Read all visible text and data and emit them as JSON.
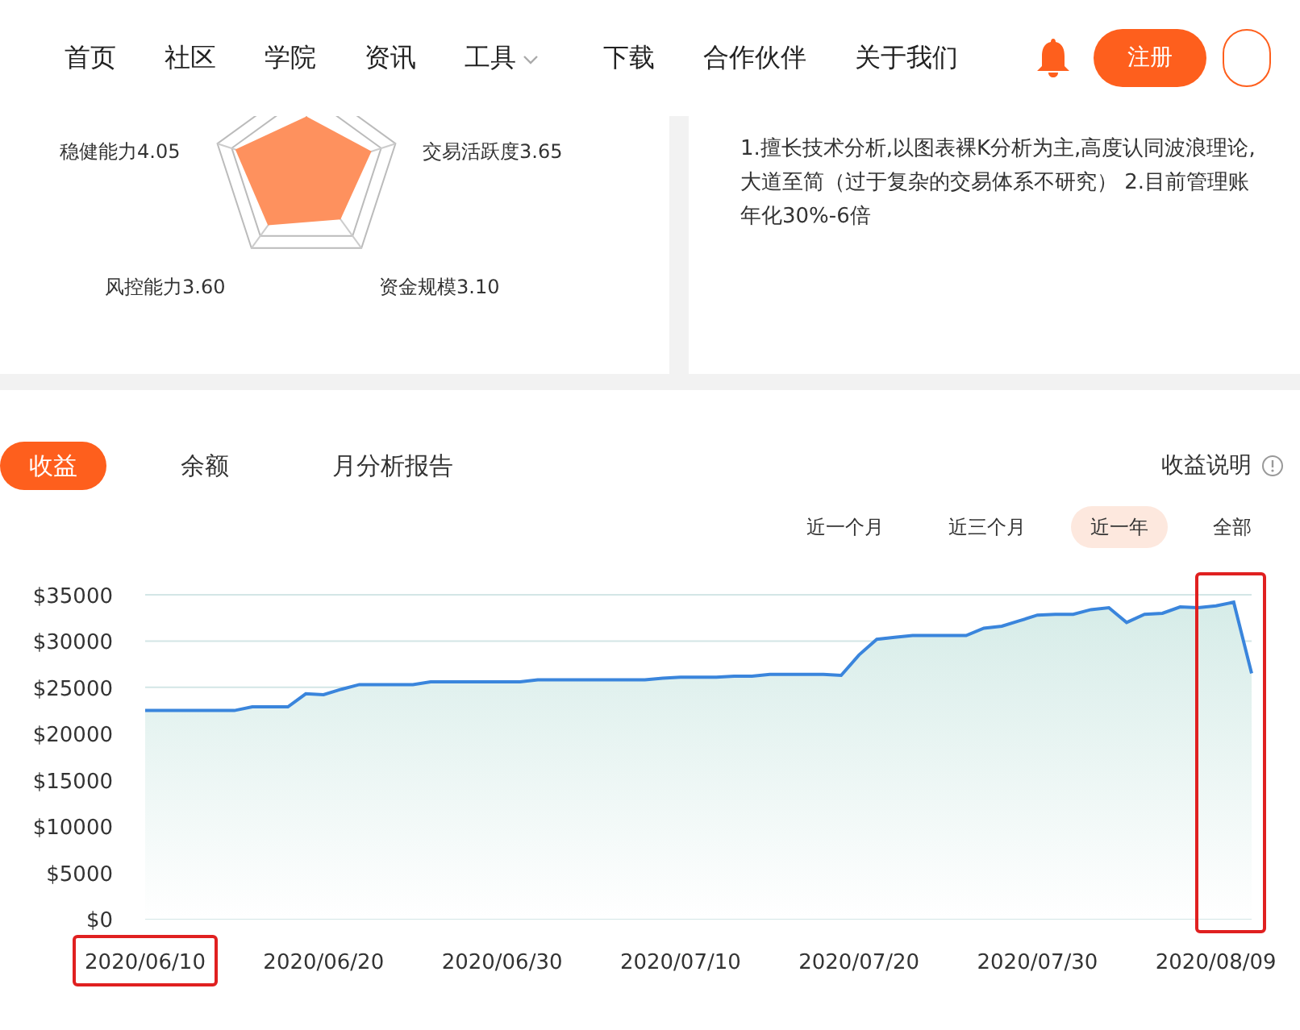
{
  "nav": {
    "items": [
      {
        "label": "首页",
        "dropdown": false
      },
      {
        "label": "社区",
        "dropdown": false
      },
      {
        "label": "学院",
        "dropdown": false
      },
      {
        "label": "资讯",
        "dropdown": false
      },
      {
        "label": "工具",
        "dropdown": true
      },
      {
        "label": "下载",
        "dropdown": false
      },
      {
        "label": "合作伙伴",
        "dropdown": false
      },
      {
        "label": "关于我们",
        "dropdown": false
      }
    ],
    "register": "注册"
  },
  "radar": {
    "labels": [
      {
        "text": "稳健能力4.05"
      },
      {
        "text": "交易活跃度3.65"
      },
      {
        "text": "风控能力3.60"
      },
      {
        "text": "资金规模3.10"
      }
    ]
  },
  "description": {
    "lines": [
      "1.擅长技术分析,以图表裸K分析为主,高度认同波浪理论,",
      "大道至简（过于复杂的交易体系不研究） 2.目前管理账",
      "年化30%-6倍"
    ]
  },
  "tabs": [
    {
      "label": "收益",
      "selected": true
    },
    {
      "label": "余额",
      "selected": false
    },
    {
      "label": "月分析报告",
      "selected": false
    }
  ],
  "explain": "收益说明",
  "ranges": [
    {
      "label": "近一个月",
      "selected": false
    },
    {
      "label": "近三个月",
      "selected": false
    },
    {
      "label": "近一年",
      "selected": true
    },
    {
      "label": "全部",
      "selected": false
    }
  ],
  "chart_data": {
    "type": "area",
    "ylim": [
      0,
      35000
    ],
    "yticks": [
      {
        "value": 0,
        "label": "$0"
      },
      {
        "value": 5000,
        "label": "$5000"
      },
      {
        "value": 10000,
        "label": "$10000"
      },
      {
        "value": 15000,
        "label": "$15000"
      },
      {
        "value": 20000,
        "label": "$20000"
      },
      {
        "value": 25000,
        "label": "$25000"
      },
      {
        "value": 30000,
        "label": "$30000"
      },
      {
        "value": 35000,
        "label": "$35000"
      }
    ],
    "categories": [
      "2020/06/10",
      null,
      null,
      null,
      null,
      null,
      null,
      null,
      null,
      null,
      "2020/06/20",
      null,
      null,
      null,
      null,
      null,
      null,
      null,
      null,
      null,
      "2020/06/30",
      null,
      null,
      null,
      null,
      null,
      null,
      null,
      null,
      null,
      "2020/07/10",
      null,
      null,
      null,
      null,
      null,
      null,
      null,
      null,
      null,
      "2020/07/20",
      null,
      null,
      null,
      null,
      null,
      null,
      null,
      null,
      null,
      "2020/07/30",
      null,
      null,
      null,
      null,
      null,
      null,
      null,
      null,
      null,
      "2020/08/09",
      null,
      null
    ],
    "series": [
      {
        "color": "#3a85dc",
        "values": [
          22500,
          22500,
          22500,
          22500,
          22500,
          22500,
          22900,
          22900,
          22900,
          24300,
          24200,
          24800,
          25300,
          25300,
          25300,
          25300,
          25600,
          25600,
          25600,
          25600,
          25600,
          25600,
          25800,
          25800,
          25800,
          25800,
          25800,
          25800,
          25800,
          26000,
          26100,
          26100,
          26100,
          26200,
          26200,
          26400,
          26400,
          26400,
          26400,
          26300,
          28500,
          30200,
          30400,
          30600,
          30600,
          30600,
          30600,
          31400,
          31600,
          32200,
          32800,
          32900,
          32900,
          33400,
          33600,
          32000,
          32900,
          33000,
          33700,
          33600,
          33800,
          34200,
          26500
        ]
      }
    ]
  }
}
